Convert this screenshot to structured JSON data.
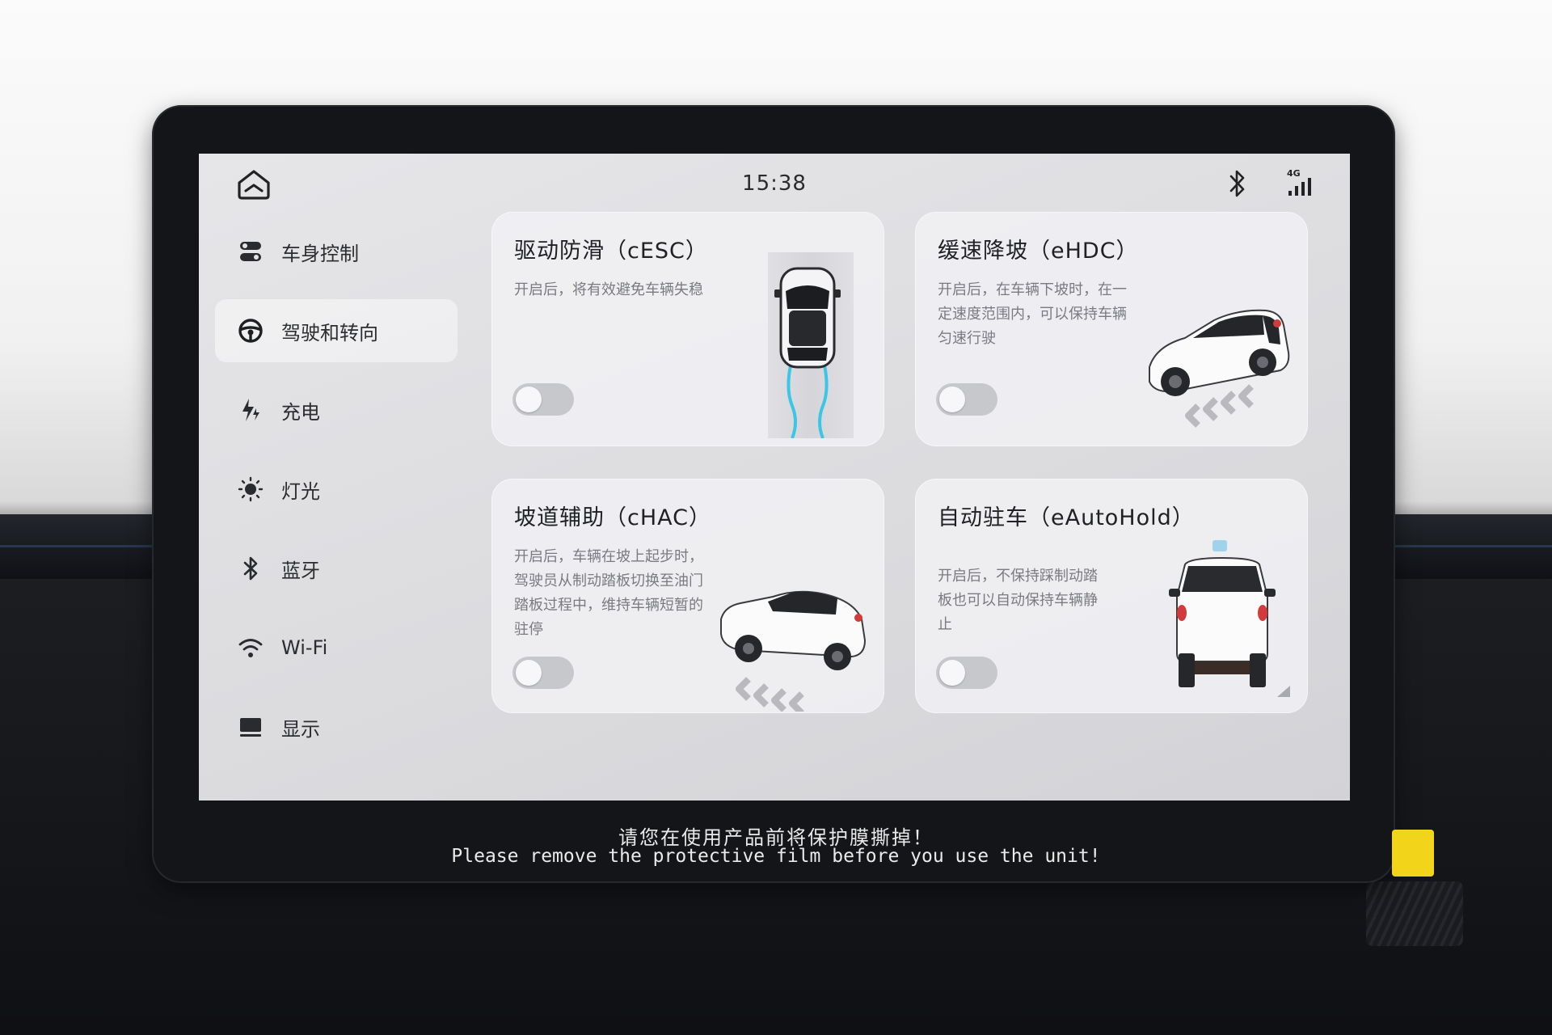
{
  "status_bar": {
    "time": "15:38",
    "icons": [
      "home-icon",
      "bluetooth-icon",
      "signal-4g-icon"
    ],
    "network": "4G"
  },
  "sidebar": {
    "items": [
      {
        "label": "车身控制",
        "icon": "body-control-icon",
        "active": false
      },
      {
        "label": "驾驶和转向",
        "icon": "steering-wheel-icon",
        "active": true
      },
      {
        "label": "充电",
        "icon": "charging-icon",
        "active": false
      },
      {
        "label": "灯光",
        "icon": "light-icon",
        "active": false
      },
      {
        "label": "蓝牙",
        "icon": "bluetooth-icon",
        "active": false
      },
      {
        "label": "Wi-Fi",
        "icon": "wifi-icon",
        "active": false
      },
      {
        "label": "显示",
        "icon": "display-icon",
        "active": false
      }
    ]
  },
  "cards": [
    {
      "title": "驱动防滑（cESC）",
      "desc_lines": [
        "开启后，将有效避免车辆失稳"
      ],
      "enabled": false
    },
    {
      "title": "缓速降坡（eHDC）",
      "desc_lines": [
        "开启后，在车辆下坡时，在一",
        "定速度范围内，可以保持车辆",
        "匀速行驶"
      ],
      "enabled": false
    },
    {
      "title": "坡道辅助（cHAC）",
      "desc_lines": [
        "开启后，车辆在坡上起步时，",
        "驾驶员从制动踏板切换至油门",
        "踏板过程中，维持车辆短暂的",
        "驻停"
      ],
      "enabled": false
    },
    {
      "title": "自动驻车（eAutoHold）",
      "desc_lines": [
        "开启后，不保持踩制动踏",
        "板也可以自动保持车辆静",
        "止"
      ],
      "enabled": false
    }
  ],
  "protective_film": {
    "cn": "请您在使用产品前将保护膜撕掉！",
    "en": "Please remove the protective film before you use the unit!"
  },
  "colors": {
    "screen_bg": "#dcdcdf",
    "card_bg": "#f1f1f4",
    "toggle_off": "#c7c8cc",
    "accent_track": "#3cc6e6",
    "bezel": "#141518"
  }
}
